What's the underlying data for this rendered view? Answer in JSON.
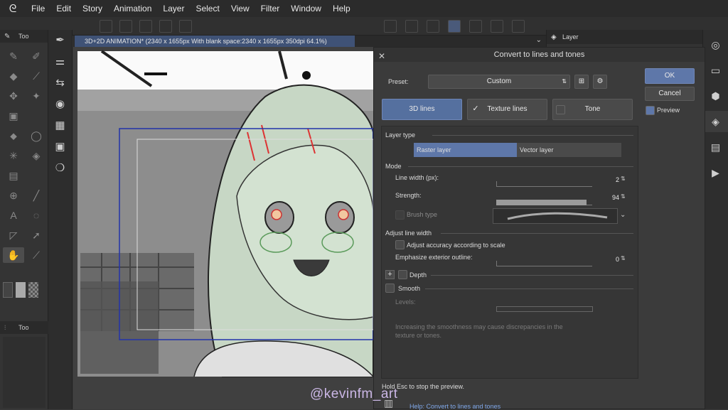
{
  "menu": {
    "items": [
      "File",
      "Edit",
      "Story",
      "Animation",
      "Layer",
      "Select",
      "View",
      "Filter",
      "Window",
      "Help"
    ]
  },
  "left_panel": {
    "tool_header": "Too",
    "sub_header": "Too"
  },
  "right_panel": {
    "layer_header": "Layer"
  },
  "document_tab": {
    "title": "3D+2D ANIMATION* (2340 x 1655px With blank space:2340 x 1655px 350dpi 64.1%)"
  },
  "dialog": {
    "title": "Convert to lines and tones",
    "preset_label": "Preset:",
    "preset_value": "Custom",
    "ok": "OK",
    "cancel": "Cancel",
    "preview": "Preview",
    "tabs": [
      {
        "label": "3D lines",
        "active": true
      },
      {
        "label": "Texture lines",
        "checked": true
      },
      {
        "label": "Tone",
        "checked": false
      }
    ],
    "layer_type_label": "Layer type",
    "layer_type_options": [
      "Raster layer",
      "Vector layer"
    ],
    "mode_label": "Mode",
    "line_width_label": "Line width (px):",
    "line_width_value": "2",
    "strength_label": "Strength:",
    "strength_value": "94",
    "brush_type_label": "Brush type",
    "adjust_line_width_label": "Adjust line width",
    "adjust_accuracy_label": "Adjust accuracy according to scale",
    "emphasize_label": "Emphasize exterior outline:",
    "emphasize_value": "0",
    "depth_label": "Depth",
    "smooth_label": "Smooth",
    "levels_label": "Levels:",
    "note": "Increasing the smoothness may cause discrepancies in the texture or tones.",
    "status": "Hold Esc to stop the preview.",
    "help_link": "Help: Convert to lines and tones"
  },
  "watermark": "@kevinfm_art",
  "colors": {
    "accent": "#5e77a9",
    "tab_blue": "#3f5276",
    "link": "#7fa7e8"
  },
  "values": {
    "line_width_fraction": 0.02,
    "strength_fraction": 0.94,
    "emphasize_fraction": 0.0
  }
}
